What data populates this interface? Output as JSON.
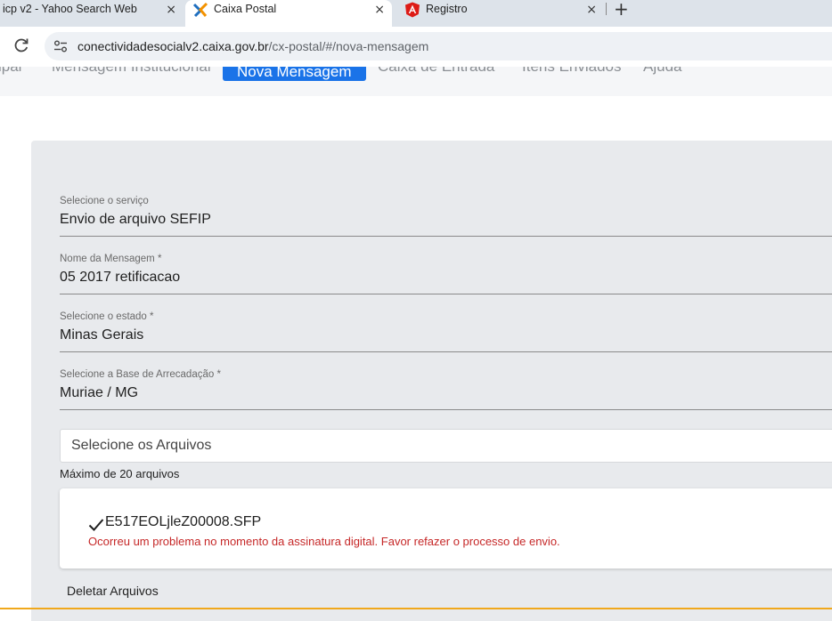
{
  "browser": {
    "tabs": [
      {
        "title": "icp v2 - Yahoo Search Web",
        "close": "×"
      },
      {
        "title": "Caixa Postal",
        "close": "×"
      },
      {
        "title": "Registro",
        "close": "×"
      }
    ],
    "new_tab": "+",
    "url_host": "conectividadesocialv2.caixa.gov.br",
    "url_path": "/cx-postal/#/nova-mensagem"
  },
  "nav": {
    "items": [
      {
        "label": "ipal"
      },
      {
        "label": "Mensagem Institucional"
      },
      {
        "label": "Nova Mensagem"
      },
      {
        "label": "Caixa de Entrada"
      },
      {
        "label": "Itens Enviados"
      },
      {
        "label": "Ajuda"
      }
    ]
  },
  "form": {
    "service": {
      "label": "Selecione o serviço",
      "value": "Envio de arquivo SEFIP"
    },
    "message_name": {
      "label": "Nome da Mensagem *",
      "value": "05 2017 retificacao"
    },
    "state": {
      "label": "Selecione o estado *",
      "value": "Minas Gerais"
    },
    "base": {
      "label": "Selecione a Base de Arrecadação *",
      "value": "Muriae / MG"
    },
    "files_placeholder": "Selecione os Arquivos",
    "max_note": "Máximo de 20 arquivos",
    "file": {
      "name": "E517EOLjleZ00008.SFP",
      "error": "Ocorreu um problema no momento da assinatura digital. Favor refazer o processo de envio."
    },
    "delete_label": "Deletar Arquivos"
  },
  "colors": {
    "accent": "#1a73e8",
    "error": "#c62828",
    "panel": "#e8eaed"
  }
}
